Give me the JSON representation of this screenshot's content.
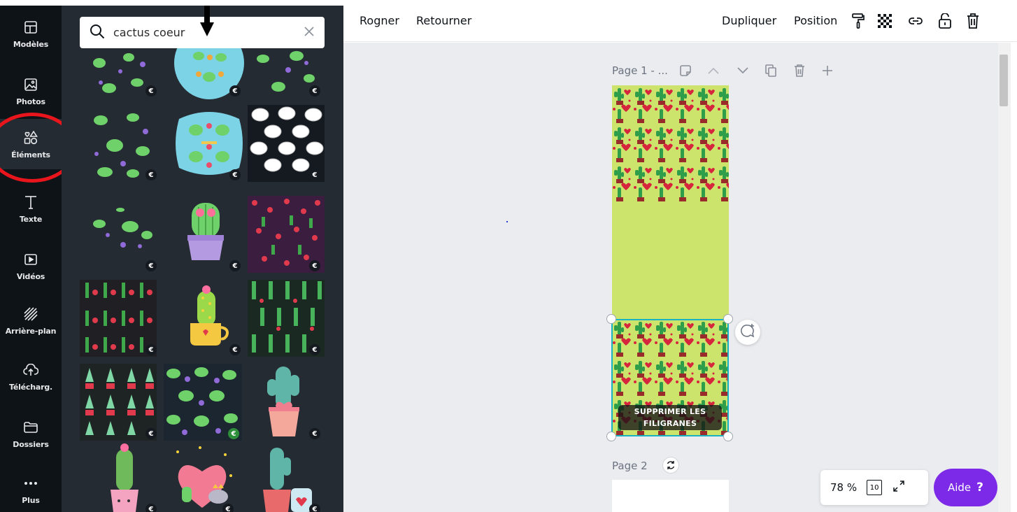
{
  "search": {
    "query": "cactus coeur"
  },
  "nav": [
    {
      "label": "Modèles"
    },
    {
      "label": "Photos"
    },
    {
      "label": "Éléments"
    },
    {
      "label": "Texte"
    },
    {
      "label": "Vidéos"
    },
    {
      "label": "Arrière-plan"
    },
    {
      "label": "Télécharg."
    },
    {
      "label": "Dossiers"
    },
    {
      "label": "Plus"
    }
  ],
  "toolbar": {
    "crop": "Rogner",
    "flip": "Retourner",
    "duplicate": "Dupliquer",
    "position": "Position"
  },
  "page1": {
    "label": "Page 1 - ..."
  },
  "watermark": {
    "line1": "SUPPRIMER LES",
    "line2": "FILIGRANES"
  },
  "page2": {
    "label": "Page 2"
  },
  "zoom": {
    "value": "78 %",
    "pages": "10"
  },
  "help": {
    "label": "Aide",
    "mark": "?"
  },
  "badge": {
    "symbol": "€"
  },
  "colors": {
    "accent": "#7d2ae8",
    "selection": "#19b2c2",
    "annotation": "#e8161c",
    "page_bg": "#cde46c"
  }
}
